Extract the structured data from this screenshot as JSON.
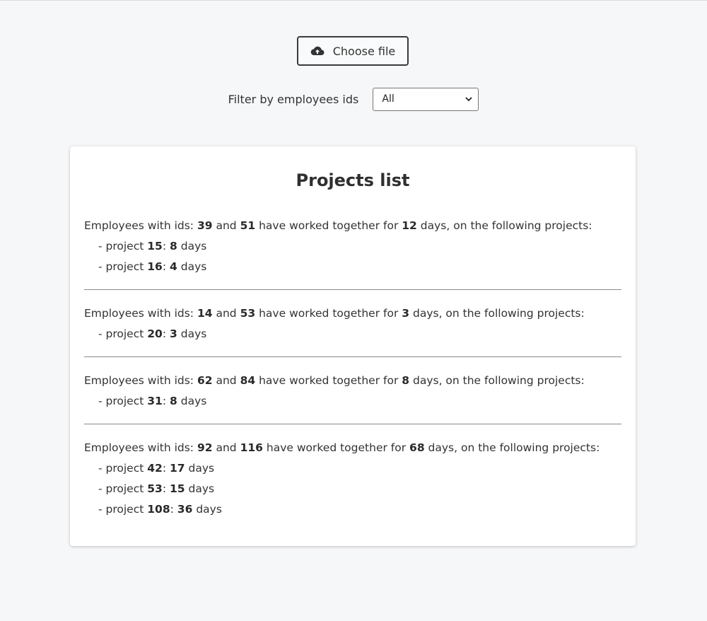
{
  "upload": {
    "label": "Choose file",
    "icon": "cloud-upload-icon"
  },
  "filter": {
    "label": "Filter by employees ids",
    "selected": "All"
  },
  "card": {
    "title": "Projects list",
    "text": {
      "prefix": "Employees with ids:",
      "and": "and",
      "have_worked": "have worked together for",
      "days_suffix": "days, on the following projects:",
      "project_prefix": "- project",
      "colon": ":",
      "days": "days"
    },
    "pairs": [
      {
        "emp1": "39",
        "emp2": "51",
        "total": "12",
        "projects": [
          {
            "id": "15",
            "days": "8"
          },
          {
            "id": "16",
            "days": "4"
          }
        ]
      },
      {
        "emp1": "14",
        "emp2": "53",
        "total": "3",
        "projects": [
          {
            "id": "20",
            "days": "3"
          }
        ]
      },
      {
        "emp1": "62",
        "emp2": "84",
        "total": "8",
        "projects": [
          {
            "id": "31",
            "days": "8"
          }
        ]
      },
      {
        "emp1": "92",
        "emp2": "116",
        "total": "68",
        "projects": [
          {
            "id": "42",
            "days": "17"
          },
          {
            "id": "53",
            "days": "15"
          },
          {
            "id": "108",
            "days": "36"
          }
        ]
      }
    ]
  }
}
